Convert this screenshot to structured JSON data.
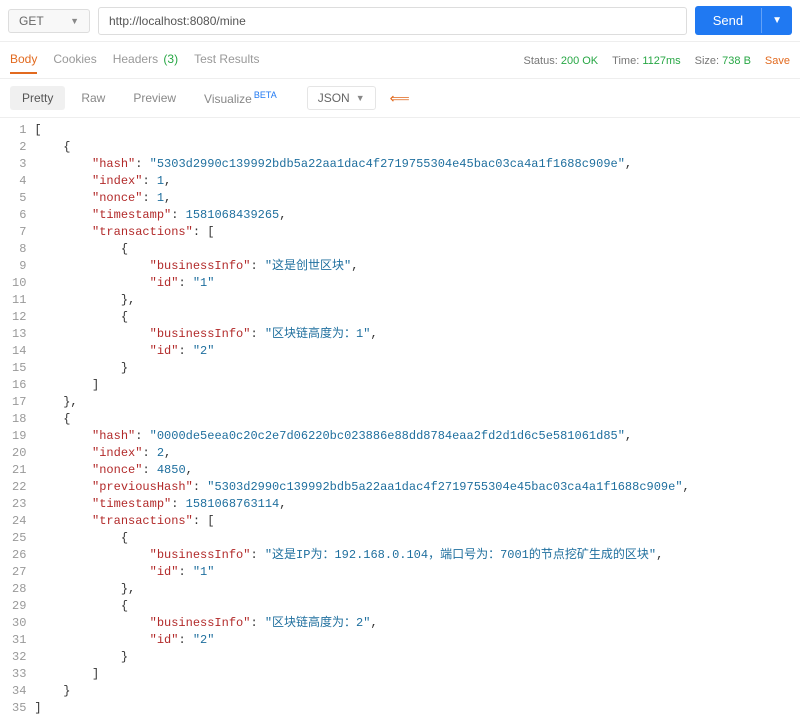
{
  "request": {
    "method": "GET",
    "url": "http://localhost:8080/mine",
    "send_label": "Send"
  },
  "tabs": {
    "body": "Body",
    "cookies": "Cookies",
    "headers": "Headers",
    "headers_count": "(3)",
    "test_results": "Test Results"
  },
  "status": {
    "status_label": "Status:",
    "status_value": "200 OK",
    "time_label": "Time:",
    "time_value": "1127ms",
    "size_label": "Size:",
    "size_value": "738 B",
    "save": "Save"
  },
  "view": {
    "pretty": "Pretty",
    "raw": "Raw",
    "preview": "Preview",
    "visualize": "Visualize",
    "beta": "BETA",
    "json": "JSON"
  },
  "response": [
    {
      "hash": "5303d2990c139992bdb5a22aa1dac4f2719755304e45bac03ca4a1f1688c909e",
      "index": 1,
      "nonce": 1,
      "timestamp": 1581068439265,
      "transactions": [
        {
          "businessInfo": "这是创世区块",
          "id": "1"
        },
        {
          "businessInfo": "区块链高度为：1",
          "id": "2"
        }
      ]
    },
    {
      "hash": "0000de5eea0c20c2e7d06220bc023886e88dd8784eaa2fd2d1d6c5e581061d85",
      "index": 2,
      "nonce": 4850,
      "previousHash": "5303d2990c139992bdb5a22aa1dac4f2719755304e45bac03ca4a1f1688c909e",
      "timestamp": 1581068763114,
      "transactions": [
        {
          "businessInfo": "这是IP为：192.168.0.104，端口号为：7001的节点挖矿生成的区块",
          "id": "1"
        },
        {
          "businessInfo": "区块链高度为：2",
          "id": "2"
        }
      ]
    }
  ]
}
